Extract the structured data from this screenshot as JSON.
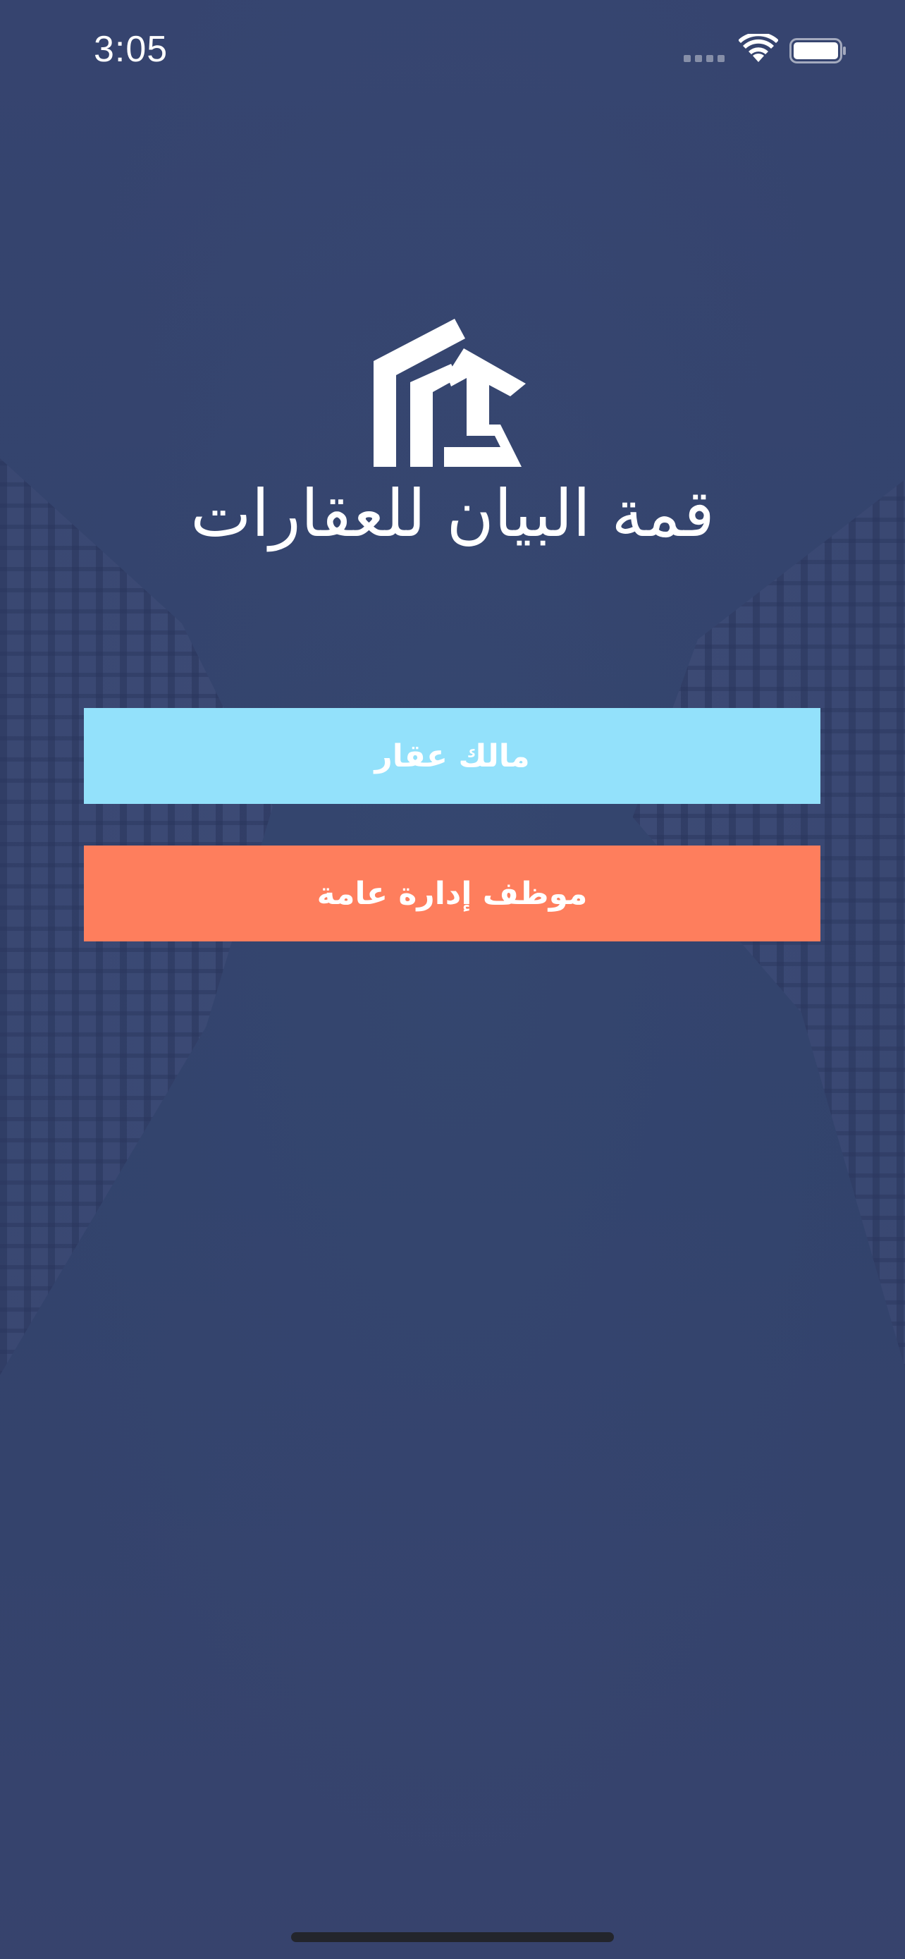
{
  "status_bar": {
    "time": "3:05",
    "signal_icon": "cellular-signal-icon",
    "wifi_icon": "wifi-icon",
    "battery_icon": "battery-icon"
  },
  "brand": {
    "logo_icon": "house-logo-icon",
    "title": "قمة البيان للعقارات"
  },
  "buttons": {
    "owner_label": "مالك عقار",
    "employee_label": "موظف إدارة عامة"
  },
  "colors": {
    "background": "#38476e",
    "owner_button": "#93e1fb",
    "employee_button": "#fe7e5d",
    "text": "#ffffff"
  }
}
